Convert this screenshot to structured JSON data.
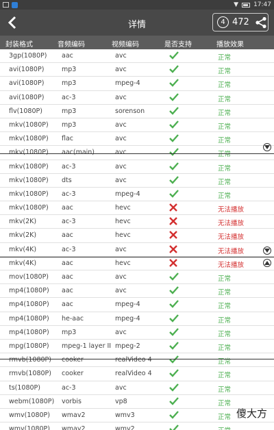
{
  "status_bar": {
    "time": "17:47"
  },
  "header": {
    "title": "详情",
    "badge_number": "4",
    "count": "472",
    "back_icon": "chevron-left-icon",
    "share_icon": "share-icon"
  },
  "columns": [
    "封装格式",
    "音频编码",
    "视频编码",
    "是否支持",
    "播放效果"
  ],
  "rows": [
    {
      "fmt": "3gp(1080P)",
      "audio": "aac",
      "video": "avc",
      "ok": true,
      "effect": "正常"
    },
    {
      "fmt": "avi(1080P)",
      "audio": "mp3",
      "video": "avc",
      "ok": true,
      "effect": "正常"
    },
    {
      "fmt": "avi(1080P)",
      "audio": "mp3",
      "video": "mpeg-4",
      "ok": true,
      "effect": "正常"
    },
    {
      "fmt": "avi(1080P)",
      "audio": "ac-3",
      "video": "avc",
      "ok": true,
      "effect": "正常"
    },
    {
      "fmt": "flv(1080P)",
      "audio": "mp3",
      "video": "sorenson",
      "ok": true,
      "effect": "正常"
    },
    {
      "fmt": "mkv(1080P)",
      "audio": "mp3",
      "video": "avc",
      "ok": true,
      "effect": "正常"
    },
    {
      "fmt": "mkv(1080P)",
      "audio": "flac",
      "video": "avc",
      "ok": true,
      "effect": "正常"
    },
    {
      "fmt": "mkv(1080P)",
      "audio": "aac(main)",
      "video": "avc",
      "ok": true,
      "effect": "正常"
    },
    {
      "fmt": "mkv(1080P)",
      "audio": "ac-3",
      "video": "avc",
      "ok": true,
      "effect": "正常"
    },
    {
      "fmt": "mkv(1080P)",
      "audio": "dts",
      "video": "avc",
      "ok": true,
      "effect": "正常"
    },
    {
      "fmt": "mkv(1080P)",
      "audio": "ac-3",
      "video": "mpeg-4",
      "ok": true,
      "effect": "正常"
    },
    {
      "fmt": "mkv(1080P)",
      "audio": "aac",
      "video": "hevc",
      "ok": false,
      "effect": "无法播放"
    },
    {
      "fmt": "mkv(2K)",
      "audio": "ac-3",
      "video": "hevc",
      "ok": false,
      "effect": "无法播放"
    },
    {
      "fmt": "mkv(2K)",
      "audio": "aac",
      "video": "hevc",
      "ok": false,
      "effect": "无法播放"
    },
    {
      "fmt": "mkv(4K)",
      "audio": "ac-3",
      "video": "avc",
      "ok": false,
      "effect": "无法播放"
    },
    {
      "fmt": "mkv(4K)",
      "audio": "aac",
      "video": "hevc",
      "ok": false,
      "effect": "无法播放"
    },
    {
      "fmt": "mov(1080P)",
      "audio": "aac",
      "video": "avc",
      "ok": true,
      "effect": "正常"
    },
    {
      "fmt": "mp4(1080P)",
      "audio": "aac",
      "video": "avc",
      "ok": true,
      "effect": "正常"
    },
    {
      "fmt": "mp4(1080P)",
      "audio": "aac",
      "video": "mpeg-4",
      "ok": true,
      "effect": "正常"
    },
    {
      "fmt": "mp4(1080P)",
      "audio": "he-aac",
      "video": "mpeg-4",
      "ok": true,
      "effect": "正常"
    },
    {
      "fmt": "mp4(1080P)",
      "audio": "mp3",
      "video": "avc",
      "ok": true,
      "effect": "正常"
    },
    {
      "fmt": "mpg(1080P)",
      "audio": "mpeg-1 layer II",
      "video": "mpeg-2",
      "ok": true,
      "effect": "正常"
    },
    {
      "fmt": "rmvb(1080P)",
      "audio": "cooker",
      "video": "realVideo 4",
      "ok": true,
      "effect": "正常"
    },
    {
      "fmt": "rmvb(1080P)",
      "audio": "cooker",
      "video": "realVideo 4",
      "ok": true,
      "effect": "正常"
    },
    {
      "fmt": "ts(1080P)",
      "audio": "ac-3",
      "video": "avc",
      "ok": true,
      "effect": "正常"
    },
    {
      "fmt": "webm(1080P)",
      "audio": "vorbis",
      "video": "vp8",
      "ok": true,
      "effect": "正常"
    },
    {
      "fmt": "wmv(1080P)",
      "audio": "wmav2",
      "video": "wmv3",
      "ok": true,
      "effect": "正常"
    },
    {
      "fmt": "wmv(1080P)",
      "audio": "wmav2",
      "video": "wmv2",
      "ok": true,
      "effect": "正常"
    }
  ],
  "colors": {
    "ok": "#4caf50",
    "bad": "#d32f2f"
  },
  "watermark": "傻大方"
}
